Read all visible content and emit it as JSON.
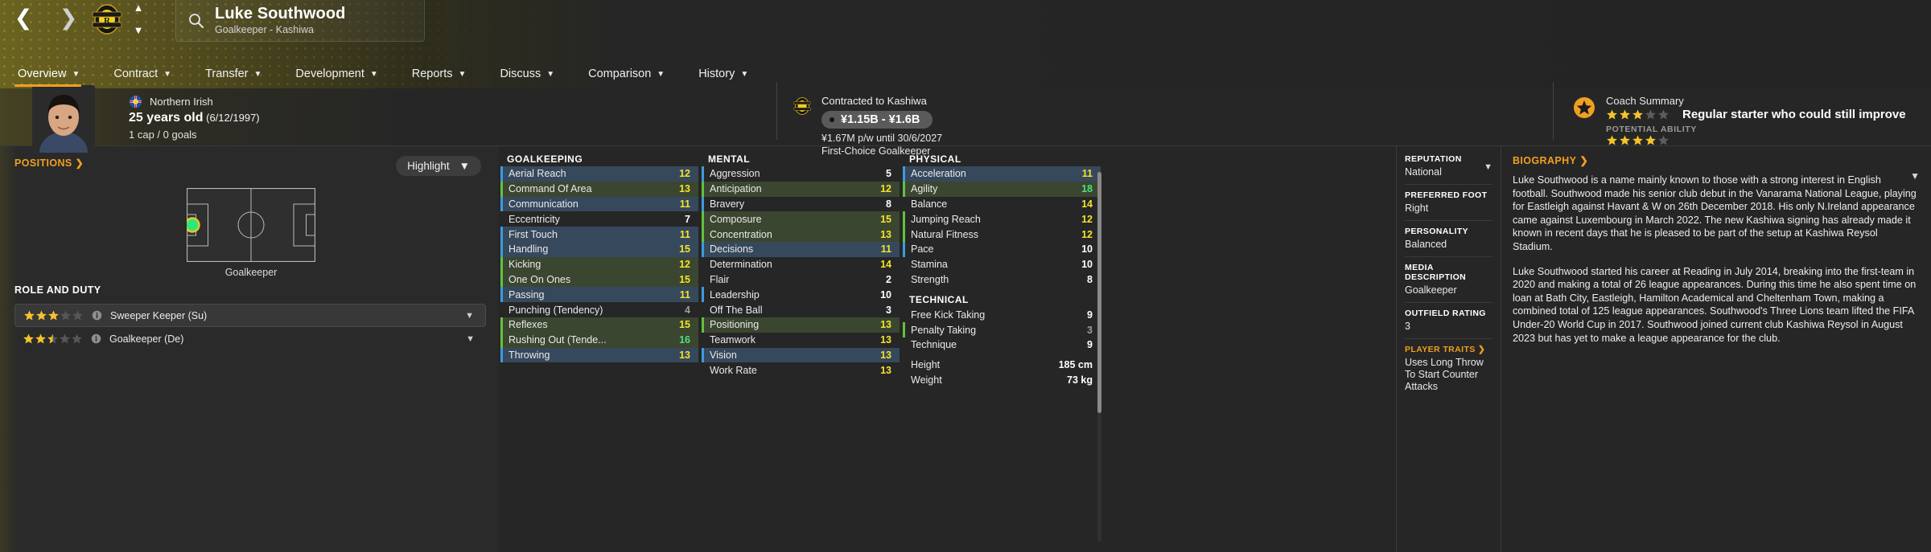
{
  "header": {
    "back_icon": "chevron-left-icon",
    "forward_icon": "chevron-right-icon",
    "club_badge_icon": "kashiwa-reysol-badge",
    "up_icon": "chevron-up-icon",
    "down_icon": "chevron-down-icon",
    "search_icon": "magnifier-icon",
    "player_name": "Luke Southwood",
    "player_subtitle": "Goalkeeper - Kashiwa",
    "tabs": [
      {
        "label": "Overview",
        "active": true
      },
      {
        "label": "Contract",
        "active": false
      },
      {
        "label": "Transfer",
        "active": false
      },
      {
        "label": "Development",
        "active": false
      },
      {
        "label": "Reports",
        "active": false
      },
      {
        "label": "Discuss",
        "active": false
      },
      {
        "label": "Comparison",
        "active": false
      },
      {
        "label": "History",
        "active": false
      }
    ]
  },
  "identity": {
    "nationality": "Northern Irish",
    "age": "25 years old",
    "dob": "(6/12/1997)",
    "caps": "1 cap / 0 goals"
  },
  "contract": {
    "club_line": "Contracted to Kashiwa",
    "value": "¥1.15B - ¥1.6B",
    "wage": "¥1.67M p/w until 30/6/2027",
    "squad_status": "First-Choice Goalkeeper"
  },
  "coach_summary": {
    "title": "Coach Summary",
    "verdict": "Regular starter who could still improve",
    "current_stars": 3,
    "potential_label": "POTENTIAL ABILITY",
    "potential_stars": 4,
    "max_stars": 5
  },
  "positions": {
    "header": "POSITIONS",
    "highlight_label": "Highlight",
    "pitch_position_label": "Goalkeeper",
    "marker_color": "#2ee87a"
  },
  "role_and_duty": {
    "header": "ROLE AND DUTY",
    "roles": [
      {
        "name": "Sweeper Keeper (Su)",
        "stars": 3,
        "selected": true
      },
      {
        "name": "Goalkeeper (De)",
        "stars": 2.5,
        "selected": false
      }
    ]
  },
  "attributes": {
    "goalkeeping": {
      "header": "GOALKEEPING",
      "rows": [
        {
          "name": "Aerial Reach",
          "value": 12,
          "hl": "blue",
          "vcolor": "yellow"
        },
        {
          "name": "Command Of Area",
          "value": 13,
          "hl": "green",
          "vcolor": "yellow"
        },
        {
          "name": "Communication",
          "value": 11,
          "hl": "blue",
          "vcolor": "yellow"
        },
        {
          "name": "Eccentricity",
          "value": 7,
          "hl": "none",
          "vcolor": "white"
        },
        {
          "name": "First Touch",
          "value": 11,
          "hl": "blue",
          "vcolor": "yellow"
        },
        {
          "name": "Handling",
          "value": 15,
          "hl": "blue",
          "vcolor": "yellow"
        },
        {
          "name": "Kicking",
          "value": 12,
          "hl": "green",
          "vcolor": "yellow"
        },
        {
          "name": "One On Ones",
          "value": 15,
          "hl": "green",
          "vcolor": "yellow"
        },
        {
          "name": "Passing",
          "value": 11,
          "hl": "blue",
          "vcolor": "yellow"
        },
        {
          "name": "Punching (Tendency)",
          "value": 4,
          "hl": "none",
          "vcolor": "grey"
        },
        {
          "name": "Reflexes",
          "value": 15,
          "hl": "green",
          "vcolor": "yellow"
        },
        {
          "name": "Rushing Out (Tende...",
          "value": 16,
          "hl": "green",
          "vcolor": "green"
        },
        {
          "name": "Throwing",
          "value": 13,
          "hl": "blue",
          "vcolor": "yellow"
        }
      ]
    },
    "mental": {
      "header": "MENTAL",
      "rows": [
        {
          "name": "Aggression",
          "value": 5,
          "hl": "none",
          "edge": "blue",
          "vcolor": "white"
        },
        {
          "name": "Anticipation",
          "value": 12,
          "hl": "green",
          "vcolor": "yellow"
        },
        {
          "name": "Bravery",
          "value": 8,
          "hl": "none",
          "edge": "blue",
          "vcolor": "white"
        },
        {
          "name": "Composure",
          "value": 15,
          "hl": "green",
          "vcolor": "yellow"
        },
        {
          "name": "Concentration",
          "value": 13,
          "hl": "green",
          "vcolor": "yellow"
        },
        {
          "name": "Decisions",
          "value": 11,
          "hl": "blue",
          "vcolor": "yellow"
        },
        {
          "name": "Determination",
          "value": 14,
          "hl": "none",
          "vcolor": "yellow"
        },
        {
          "name": "Flair",
          "value": 2,
          "hl": "none",
          "vcolor": "white"
        },
        {
          "name": "Leadership",
          "value": 10,
          "hl": "none",
          "edge": "blue",
          "vcolor": "white"
        },
        {
          "name": "Off The Ball",
          "value": 3,
          "hl": "none",
          "vcolor": "white"
        },
        {
          "name": "Positioning",
          "value": 13,
          "hl": "green",
          "vcolor": "yellow"
        },
        {
          "name": "Teamwork",
          "value": 13,
          "hl": "none",
          "vcolor": "yellow"
        },
        {
          "name": "Vision",
          "value": 13,
          "hl": "blue",
          "vcolor": "yellow"
        },
        {
          "name": "Work Rate",
          "value": 13,
          "hl": "none",
          "vcolor": "yellow"
        }
      ]
    },
    "physical": {
      "header": "PHYSICAL",
      "rows": [
        {
          "name": "Acceleration",
          "value": 11,
          "hl": "blue",
          "vcolor": "yellow"
        },
        {
          "name": "Agility",
          "value": 18,
          "hl": "green",
          "vcolor": "green"
        },
        {
          "name": "Balance",
          "value": 14,
          "hl": "none",
          "vcolor": "yellow"
        },
        {
          "name": "Jumping Reach",
          "value": 12,
          "hl": "none",
          "edge": "green",
          "vcolor": "yellow"
        },
        {
          "name": "Natural Fitness",
          "value": 12,
          "hl": "none",
          "edge": "green",
          "vcolor": "yellow"
        },
        {
          "name": "Pace",
          "value": 10,
          "hl": "none",
          "edge": "blue",
          "vcolor": "white"
        },
        {
          "name": "Stamina",
          "value": 10,
          "hl": "none",
          "vcolor": "white"
        },
        {
          "name": "Strength",
          "value": 8,
          "hl": "none",
          "vcolor": "white"
        }
      ]
    },
    "technical": {
      "header": "TECHNICAL",
      "rows": [
        {
          "name": "Free Kick Taking",
          "value": 9,
          "hl": "none",
          "vcolor": "white"
        },
        {
          "name": "Penalty Taking",
          "value": 3,
          "hl": "none",
          "edge": "green",
          "vcolor": "grey"
        },
        {
          "name": "Technique",
          "value": 9,
          "hl": "none",
          "vcolor": "white"
        }
      ]
    },
    "measurements": [
      {
        "name": "Height",
        "value": "185 cm"
      },
      {
        "name": "Weight",
        "value": "73 kg"
      }
    ]
  },
  "info_sidebar": [
    {
      "label": "REPUTATION",
      "value": "National",
      "accent": false,
      "chev": true
    },
    {
      "label": "PREFERRED FOOT",
      "value": "Right",
      "accent": false,
      "chev": false
    },
    {
      "label": "PERSONALITY",
      "value": "Balanced",
      "accent": false,
      "chev": false
    },
    {
      "label": "MEDIA DESCRIPTION",
      "value": "Goalkeeper",
      "accent": false,
      "chev": false
    },
    {
      "label": "OUTFIELD RATING",
      "value": "3",
      "accent": false,
      "chev": false
    },
    {
      "label": "PLAYER TRAITS",
      "value": "Uses Long Throw To Start Counter Attacks",
      "accent": true,
      "chev": false
    }
  ],
  "biography": {
    "header": "BIOGRAPHY",
    "paragraph1": "Luke Southwood is a name mainly known to those with a strong interest in English football. Southwood made his senior club debut in the Vanarama National League, playing for Eastleigh against Havant & W on 26th December 2018. His only N.Ireland appearance came against Luxembourg in March 2022. The new Kashiwa signing has already made it known in recent days that he is pleased to be part of the setup at Kashiwa Reysol Stadium.",
    "paragraph2": "Luke Southwood started his career at Reading in July 2014, breaking into the first-team in 2020 and making a total of 26 league appearances. During this time he also spent time on loan at Bath City, Eastleigh, Hamilton Academical and Cheltenham Town, making a combined total of 125 league appearances. Southwood's Three Lions team lifted the FIFA Under-20 World Cup in 2017. Southwood joined current club Kashiwa Reysol in August 2023 but has yet to make a league appearance for the club."
  }
}
